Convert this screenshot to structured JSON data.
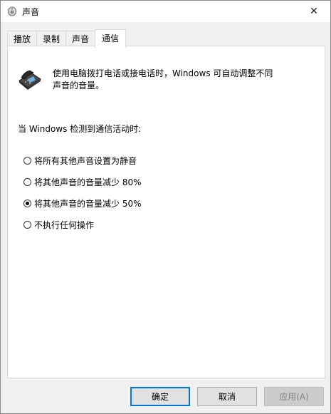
{
  "window": {
    "title": "声音",
    "close_glyph": "✕"
  },
  "tabs": [
    {
      "label": "播放",
      "active": false
    },
    {
      "label": "录制",
      "active": false
    },
    {
      "label": "声音",
      "active": false
    },
    {
      "label": "通信",
      "active": true
    }
  ],
  "content": {
    "description_line1": "使用电脑拨打电话或接电话时，Windows 可自动调整不同",
    "description_line2": "声音的音量。",
    "when_label": "当 Windows 检测到通信活动时:",
    "options": [
      {
        "label": "将所有其他声音设置为静音",
        "checked": false
      },
      {
        "label": "将其他声音的音量减少 80%",
        "checked": false
      },
      {
        "label": "将其他声音的音量减少 50%",
        "checked": true
      },
      {
        "label": "不执行任何操作",
        "checked": false
      }
    ]
  },
  "buttons": {
    "ok": "确定",
    "cancel": "取消",
    "apply": "应用(A)"
  },
  "colors": {
    "accent": "#0078d7",
    "panel_bg": "#ffffff",
    "window_bg": "#f0f0f0"
  }
}
